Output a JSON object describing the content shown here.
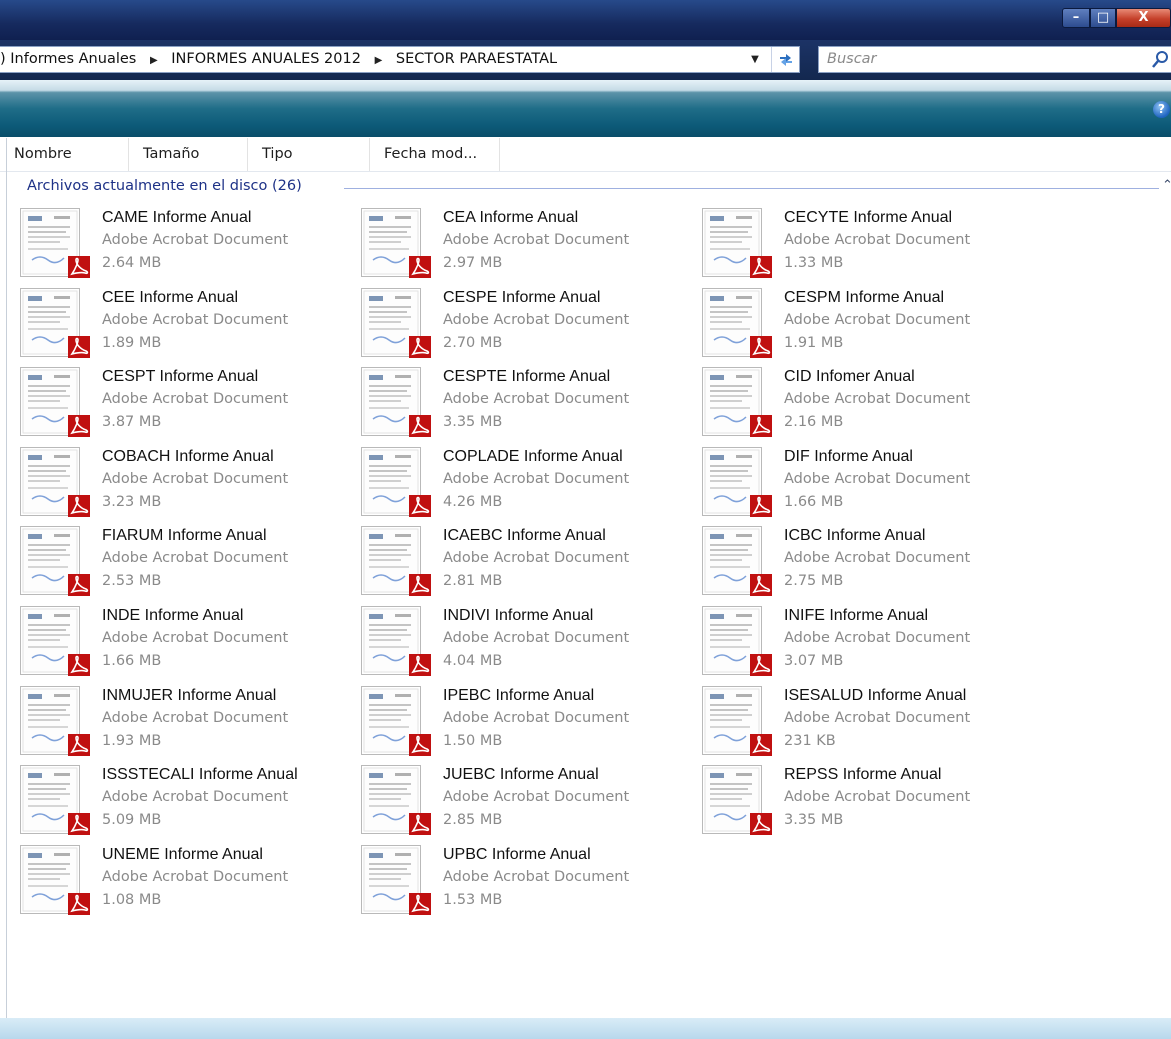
{
  "window": {
    "minimize_label": "–",
    "maximize_label": "□",
    "close_label": "X"
  },
  "address": {
    "breadcrumbs": [
      "Informes Anuales",
      "INFORMES ANUALES 2012",
      "SECTOR PARAESTATAL"
    ],
    "prefix": ")",
    "search_placeholder": "Buscar"
  },
  "toolbar": {
    "help_label": "?"
  },
  "columns": [
    "Nombre",
    "Tamaño",
    "Tipo",
    "Fecha mod..."
  ],
  "group": {
    "label": "Archivos actualmente en el disco (26)"
  },
  "files": [
    {
      "name": "CAME Informe Anual",
      "type": "Adobe Acrobat Document",
      "size": "2.64 MB"
    },
    {
      "name": "CEA Informe Anual",
      "type": "Adobe Acrobat Document",
      "size": "2.97 MB"
    },
    {
      "name": "CECYTE Informe Anual",
      "type": "Adobe Acrobat Document",
      "size": "1.33 MB"
    },
    {
      "name": "CEE Informe Anual",
      "type": "Adobe Acrobat Document",
      "size": "1.89 MB"
    },
    {
      "name": "CESPE Informe Anual",
      "type": "Adobe Acrobat Document",
      "size": "2.70 MB"
    },
    {
      "name": "CESPM Informe Anual",
      "type": "Adobe Acrobat Document",
      "size": "1.91 MB"
    },
    {
      "name": "CESPT Informe Anual",
      "type": "Adobe Acrobat Document",
      "size": "3.87 MB"
    },
    {
      "name": "CESPTE Informe Anual",
      "type": "Adobe Acrobat Document",
      "size": "3.35 MB"
    },
    {
      "name": "CID Infomer Anual",
      "type": "Adobe Acrobat Document",
      "size": "2.16 MB"
    },
    {
      "name": "COBACH Informe Anual",
      "type": "Adobe Acrobat Document",
      "size": "3.23 MB"
    },
    {
      "name": "COPLADE Informe Anual",
      "type": "Adobe Acrobat Document",
      "size": "4.26 MB"
    },
    {
      "name": "DIF Informe Anual",
      "type": "Adobe Acrobat Document",
      "size": "1.66 MB"
    },
    {
      "name": "FIARUM Informe Anual",
      "type": "Adobe Acrobat Document",
      "size": "2.53 MB"
    },
    {
      "name": "ICAEBC Informe Anual",
      "type": "Adobe Acrobat Document",
      "size": "2.81 MB"
    },
    {
      "name": "ICBC Informe Anual",
      "type": "Adobe Acrobat Document",
      "size": "2.75 MB"
    },
    {
      "name": "INDE Informe Anual",
      "type": "Adobe Acrobat Document",
      "size": "1.66 MB"
    },
    {
      "name": "INDIVI Informe Anual",
      "type": "Adobe Acrobat Document",
      "size": "4.04 MB"
    },
    {
      "name": "INIFE Informe Anual",
      "type": "Adobe Acrobat Document",
      "size": "3.07 MB"
    },
    {
      "name": "INMUJER Informe Anual",
      "type": "Adobe Acrobat Document",
      "size": "1.93 MB"
    },
    {
      "name": "IPEBC Informe Anual",
      "type": "Adobe Acrobat Document",
      "size": "1.50 MB"
    },
    {
      "name": "ISESALUD Informe Anual",
      "type": "Adobe Acrobat Document",
      "size": "231 KB"
    },
    {
      "name": "ISSSTECALI Informe Anual",
      "type": "Adobe Acrobat Document",
      "size": "5.09 MB"
    },
    {
      "name": "JUEBC Informe Anual",
      "type": "Adobe Acrobat Document",
      "size": "2.85 MB"
    },
    {
      "name": "REPSS Informe Anual",
      "type": "Adobe Acrobat Document",
      "size": "3.35 MB"
    },
    {
      "name": "UNEME Informe Anual",
      "type": "Adobe Acrobat Document",
      "size": "1.08 MB"
    },
    {
      "name": "UPBC Informe Anual",
      "type": "Adobe Acrobat Document",
      "size": "1.53 MB"
    }
  ],
  "icons": {
    "file_icon": "pdf-document-thumbnail",
    "adobe_badge": "adobe-acrobat-icon"
  },
  "colors": {
    "titlebar": "#162a5e",
    "toolbar": "#1f6d88",
    "group_label": "#1e3287",
    "pdf_red": "#c01010"
  }
}
